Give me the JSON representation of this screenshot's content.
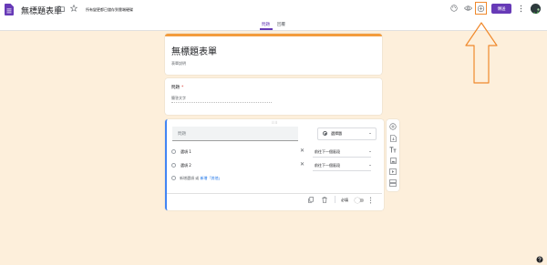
{
  "header": {
    "title": "無標題表單",
    "save_status": "所有變更都已儲存到雲端硬碟",
    "send_label": "傳送"
  },
  "tabs": [
    {
      "label": "問題",
      "active": true
    },
    {
      "label": "回覆",
      "active": false
    }
  ],
  "form": {
    "title": "無標題表單",
    "description": "表單說明"
  },
  "question1": {
    "title": "問題",
    "required_mark": "*",
    "answer_placeholder": "簡答文字"
  },
  "question2": {
    "placeholder": "問題",
    "type": "選擇題",
    "options": [
      {
        "label": "選項 1",
        "goto": "前往下一個區段"
      },
      {
        "label": "選項 2",
        "goto": "前往下一個區段"
      }
    ],
    "add_option": "新增選項 或",
    "add_other": "新增「其他」",
    "required_label": "必填"
  },
  "colors": {
    "accent": "#673ab7",
    "background": "#fdefdb",
    "header_stripe": "#f39c3d",
    "focus_border": "#4285f4",
    "annotation": "#f0892c"
  },
  "icons": {
    "side_toolbar": [
      "add-question-icon",
      "import-questions-icon",
      "add-title-icon",
      "add-image-icon",
      "add-video-icon",
      "add-section-icon"
    ]
  }
}
